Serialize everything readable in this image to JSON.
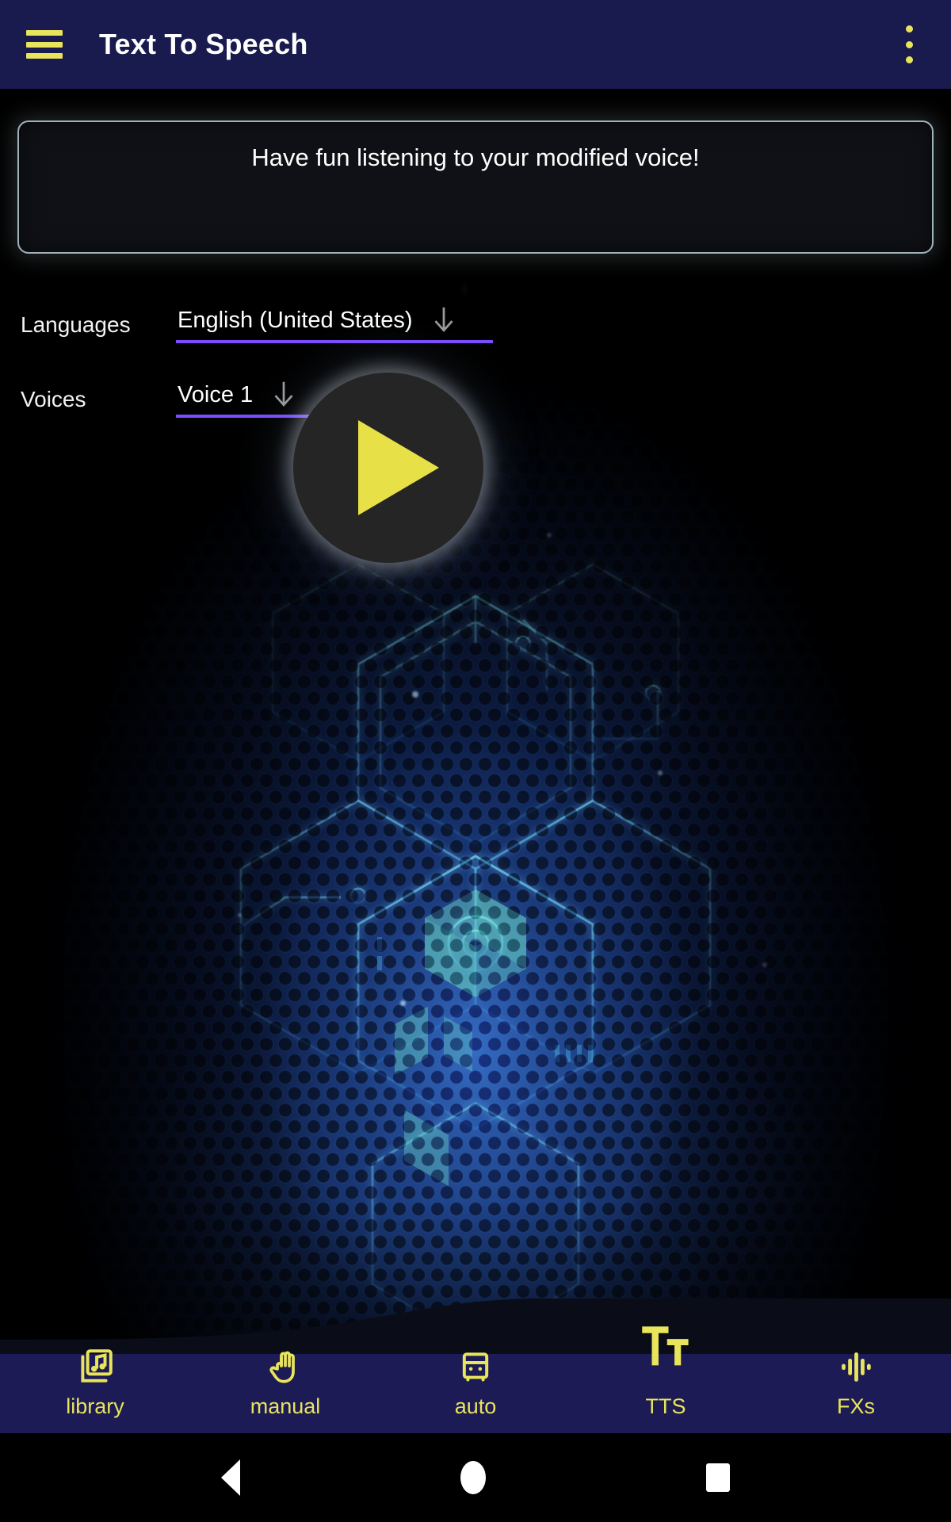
{
  "appbar": {
    "title": "Text To Speech",
    "menu_icon": "hamburger-menu-icon",
    "overflow_icon": "more-vertical-icon",
    "background_color": "#191a4e",
    "icon_color": "#e8e45c",
    "title_color": "#ffffff"
  },
  "text_input": {
    "value": "Have fun listening to your modified voice!",
    "placeholder": "Enter text to speak",
    "border_color": "#9fb3bb",
    "text_color": "#ffffff"
  },
  "spinners": [
    {
      "label": "Languages",
      "value": "English (United States)",
      "arrow_icon": "arrow-down-icon",
      "underline_color": "#7c4dff"
    },
    {
      "label": "Voices",
      "value": "Voice 1",
      "arrow_icon": "arrow-down-icon",
      "underline_color": "#7c4dff"
    }
  ],
  "play_button": {
    "icon": "play-triangle-icon",
    "circle_color": "#252525",
    "triangle_color": "#e8e047"
  },
  "bottom_nav": {
    "background_color": "#1d1b55",
    "accent_color": "#e8e45c",
    "active": "TTS",
    "items": [
      {
        "label": "library",
        "icon": "library-music-icon",
        "active": false
      },
      {
        "label": "manual",
        "icon": "hand-icon",
        "active": false
      },
      {
        "label": "auto",
        "icon": "car-icon",
        "active": false
      },
      {
        "label": "TTS",
        "icon": "format-text-size-icon",
        "active": true
      },
      {
        "label": "FXs",
        "icon": "audio-waveform-icon",
        "active": false
      }
    ]
  },
  "system_nav": {
    "back": "back-triangle-icon",
    "home": "home-circle-icon",
    "recents": "recents-square-icon",
    "background_color": "#000000",
    "icon_color": "#ffffff"
  }
}
